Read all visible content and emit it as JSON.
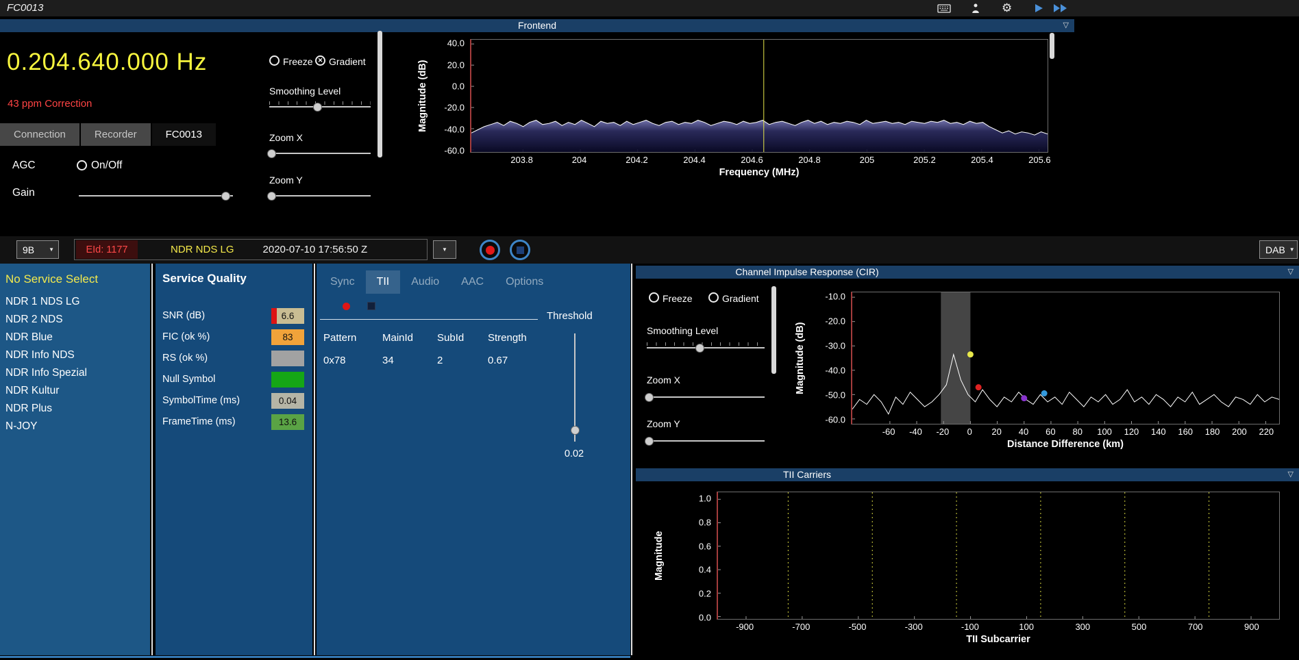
{
  "titlebar": {
    "title": "FC0013"
  },
  "frequency": {
    "value": "0.204.640.000 Hz",
    "correction": "43 ppm Correction"
  },
  "tuner": {
    "tabs": [
      "Connection",
      "Recorder",
      "FC0013"
    ],
    "selected_tab": "FC0013",
    "agc_label": "AGC",
    "agc_option": "On/Off",
    "agc_on": false,
    "gain_label": "Gain",
    "gain_pct": 95
  },
  "frontend": {
    "title": "Frontend",
    "freeze_label": "Freeze",
    "gradient_label": "Gradient",
    "freeze_checked": false,
    "gradient_checked": true,
    "smoothing_label": "Smoothing Level",
    "smoothing_pct": 47,
    "zoom_x_label": "Zoom X",
    "zoom_x_pct": 2,
    "zoom_y_label": "Zoom Y",
    "zoom_y_pct": 2
  },
  "channel_bar": {
    "channel": "9B",
    "eid": "EId: 1177",
    "ensemble": "NDR NDS LG",
    "timestamp": "2020-07-10  17:56:50 Z",
    "mode": "DAB"
  },
  "services": {
    "header": "No Service Select",
    "items": [
      "NDR 1 NDS LG",
      "NDR 2 NDS",
      "NDR Blue",
      "NDR Info NDS",
      "NDR Info Spezial",
      "NDR Kultur",
      "NDR Plus",
      "N-JOY"
    ]
  },
  "service_quality": {
    "title": "Service Quality",
    "rows": [
      {
        "label": "SNR (dB)",
        "value": "6.6",
        "base": "#c9bd93",
        "fill": "#dd1414",
        "fill_pct": 16
      },
      {
        "label": "FIC (ok %)",
        "value": "83",
        "base": "#f1a33a",
        "fill": "#f1a33a",
        "fill_pct": 100
      },
      {
        "label": "RS (ok %)",
        "value": "",
        "base": "#a2a2a2",
        "fill": "#a2a2a2",
        "fill_pct": 0
      },
      {
        "label": "Null Symbol",
        "value": "",
        "base": "#15a615",
        "fill": "#15a615",
        "fill_pct": 100
      },
      {
        "label": "SymbolTime (ms)",
        "value": "0.04",
        "base": "#b5b5a6",
        "fill": "#b5b5a6",
        "fill_pct": 0
      },
      {
        "label": "FrameTime (ms)",
        "value": "13.6",
        "base": "#5aa345",
        "fill": "#5aa345",
        "fill_pct": 100
      }
    ]
  },
  "decode": {
    "tabs": [
      "Sync",
      "TII",
      "Audio",
      "AAC",
      "Options"
    ],
    "selected_tab": "TII",
    "table": {
      "headers": [
        "Pattern",
        "MainId",
        "SubId",
        "Strength"
      ],
      "rows": [
        [
          "0x78",
          "34",
          "2",
          "0.67"
        ]
      ]
    },
    "threshold_label": "Threshold",
    "threshold_value": "0.02",
    "threshold_pct": 90
  },
  "cir": {
    "title": "Channel Impulse Response (CIR)",
    "freeze_label": "Freeze",
    "gradient_label": "Gradient",
    "freeze_checked": false,
    "gradient_checked": false,
    "smoothing_label": "Smoothing Level",
    "smoothing_pct": 45,
    "zoom_x_label": "Zoom X",
    "zoom_x_pct": 2,
    "zoom_y_label": "Zoom Y",
    "zoom_y_pct": 2
  },
  "tii_panel": {
    "title": "TII Carriers"
  },
  "chart_data": [
    {
      "id": "frontend-spectrum",
      "type": "line",
      "title": "Frontend",
      "xlabel": "Frequency (MHz)",
      "ylabel": "Magnitude (dB)",
      "xlim": [
        203.62,
        205.63
      ],
      "ylim": [
        -62,
        44
      ],
      "xticks": [
        203.8,
        204,
        204.2,
        204.4,
        204.6,
        204.8,
        205,
        205.2,
        205.4,
        205.6
      ],
      "xtick_labels": [
        "203.8",
        "204",
        "204.2",
        "204.4",
        "204.6",
        "204.8",
        "205",
        "205.2",
        "205.4",
        "205.6"
      ],
      "yticks": [
        40,
        20,
        0,
        -20,
        -40,
        -60
      ],
      "ytick_labels": [
        "40.0",
        "20.0",
        "0.0",
        "-20.0",
        "-40.0",
        "-60.0"
      ],
      "marker_line_x": 204.64,
      "marker_line_color": "#e8e84a",
      "line_color": "#ffffff",
      "fill": "gradient",
      "y_values": [
        -44,
        -41,
        -38,
        -36,
        -34,
        -37,
        -33,
        -35,
        -38,
        -34,
        -32,
        -36,
        -35,
        -33,
        -37,
        -34,
        -36,
        -32,
        -35,
        -38,
        -33,
        -35,
        -34,
        -37,
        -33,
        -36,
        -34,
        -32,
        -35,
        -37,
        -34,
        -33,
        -36,
        -34,
        -35,
        -32,
        -34,
        -37,
        -35,
        -33,
        -34,
        -36,
        -33,
        -35,
        -34,
        -32,
        -36,
        -34,
        -33,
        -35,
        -37,
        -34,
        -32,
        -35,
        -33,
        -36,
        -34,
        -35,
        -33,
        -34,
        -36,
        -32,
        -35,
        -34,
        -33,
        -35,
        -34,
        -36,
        -33,
        -34,
        -35,
        -33,
        -34,
        -32,
        -35,
        -34,
        -36,
        -33,
        -35,
        -34,
        -38,
        -41,
        -44,
        -42,
        -45,
        -43,
        -44,
        -46,
        -43,
        -45
      ]
    },
    {
      "id": "cir",
      "type": "line",
      "title": "Channel Impulse Response (CIR)",
      "xlabel": "Distance Difference (km)",
      "ylabel": "Magnitude (dB)",
      "xlim": [
        -88,
        230
      ],
      "ylim": [
        -62,
        -8
      ],
      "xticks": [
        -60,
        -40,
        -20,
        0,
        20,
        40,
        60,
        80,
        100,
        120,
        140,
        160,
        180,
        200,
        220
      ],
      "yticks": [
        -10,
        -20,
        -30,
        -40,
        -50,
        -60
      ],
      "ytick_labels": [
        "-10.0",
        "-20.0",
        "-30.0",
        "-40.0",
        "-50.0",
        "-60.0"
      ],
      "region": {
        "x0": -22,
        "x1": 0,
        "color": "#8a8a8a"
      },
      "line_color": "#ffffff",
      "markers": [
        {
          "x": 0,
          "y": -33.5,
          "color": "#e8e84a"
        },
        {
          "x": 6,
          "y": -47,
          "color": "#dd2222"
        },
        {
          "x": 40,
          "y": -51.5,
          "color": "#8833cc"
        },
        {
          "x": 55,
          "y": -49.5,
          "color": "#3399dd"
        }
      ],
      "y_values": [
        -56,
        -52,
        -54,
        -50,
        -53,
        -58,
        -51,
        -54,
        -49,
        -52,
        -55,
        -53,
        -50,
        -46,
        -33.5,
        -44,
        -50,
        -53,
        -48,
        -52,
        -55,
        -51,
        -53,
        -49,
        -52,
        -54,
        -50,
        -53,
        -51,
        -54,
        -49,
        -52,
        -55,
        -51,
        -53,
        -50,
        -54,
        -52,
        -48,
        -53,
        -51,
        -54,
        -50,
        -52,
        -55,
        -51,
        -53,
        -49,
        -54,
        -52,
        -50,
        -53,
        -55,
        -51,
        -52,
        -54,
        -50,
        -53,
        -51,
        -52
      ]
    },
    {
      "id": "tii-carriers",
      "type": "line",
      "title": "TII Carriers",
      "xlabel": "TII Subcarrier",
      "ylabel": "Magnitude",
      "xlim": [
        -1000,
        1000
      ],
      "ylim": [
        -0.02,
        1.06
      ],
      "xticks": [
        -900,
        -700,
        -500,
        -300,
        -100,
        100,
        300,
        500,
        700,
        900
      ],
      "yticks": [
        1.0,
        0.8,
        0.6,
        0.4,
        0.2,
        0.0
      ],
      "ytick_labels": [
        "1.0",
        "0.8",
        "0.6",
        "0.4",
        "0.2",
        "0.0"
      ],
      "gridlines_x": [
        -750,
        -450,
        -150,
        150,
        450,
        750
      ],
      "gridline_color": "#d8d840",
      "y_values": []
    }
  ]
}
